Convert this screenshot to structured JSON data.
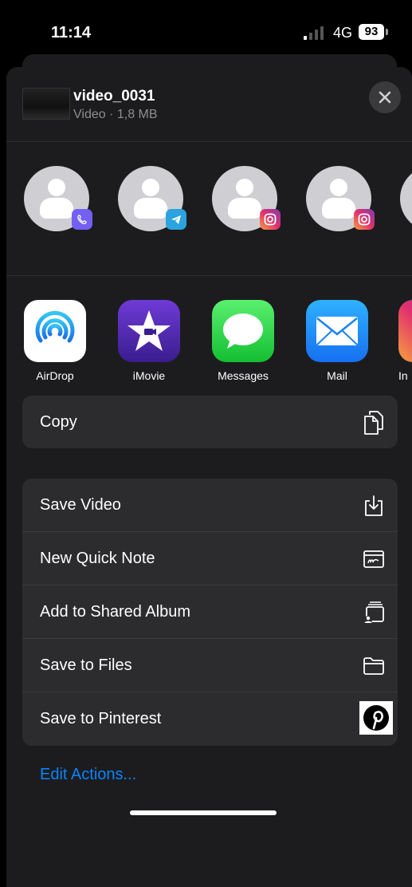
{
  "status": {
    "time": "11:14",
    "network": "4G",
    "battery": "93"
  },
  "file": {
    "name": "video_0031",
    "meta": "Video · 1,8 MB"
  },
  "people": [
    {
      "app": "viber-icon",
      "color": "#7360f2"
    },
    {
      "app": "telegram-icon",
      "color": "#2aa3e0"
    },
    {
      "app": "instagram-icon",
      "color": "#e1306c"
    },
    {
      "app": "instagram-icon",
      "color": "#e1306c"
    }
  ],
  "apps": [
    {
      "label": "AirDrop",
      "icon": "airdrop-icon"
    },
    {
      "label": "iMovie",
      "icon": "imovie-icon"
    },
    {
      "label": "Messages",
      "icon": "messages-icon"
    },
    {
      "label": "Mail",
      "icon": "mail-icon"
    },
    {
      "label": "In",
      "icon": "instagram-icon"
    }
  ],
  "copy_group": [
    {
      "label": "Copy",
      "icon": "copy-icon"
    }
  ],
  "actions": [
    {
      "label": "Save Video",
      "icon": "download-icon"
    },
    {
      "label": "New Quick Note",
      "icon": "quick-note-icon"
    },
    {
      "label": "Add to Shared Album",
      "icon": "shared-album-icon"
    },
    {
      "label": "Save to Files",
      "icon": "folder-icon"
    },
    {
      "label": "Save to Pinterest",
      "icon": "pinterest-icon"
    }
  ],
  "edit_actions": "Edit Actions...",
  "colors": {
    "accent": "#0a84ff",
    "sheet": "#1c1c1e",
    "row": "#2c2c2e"
  }
}
